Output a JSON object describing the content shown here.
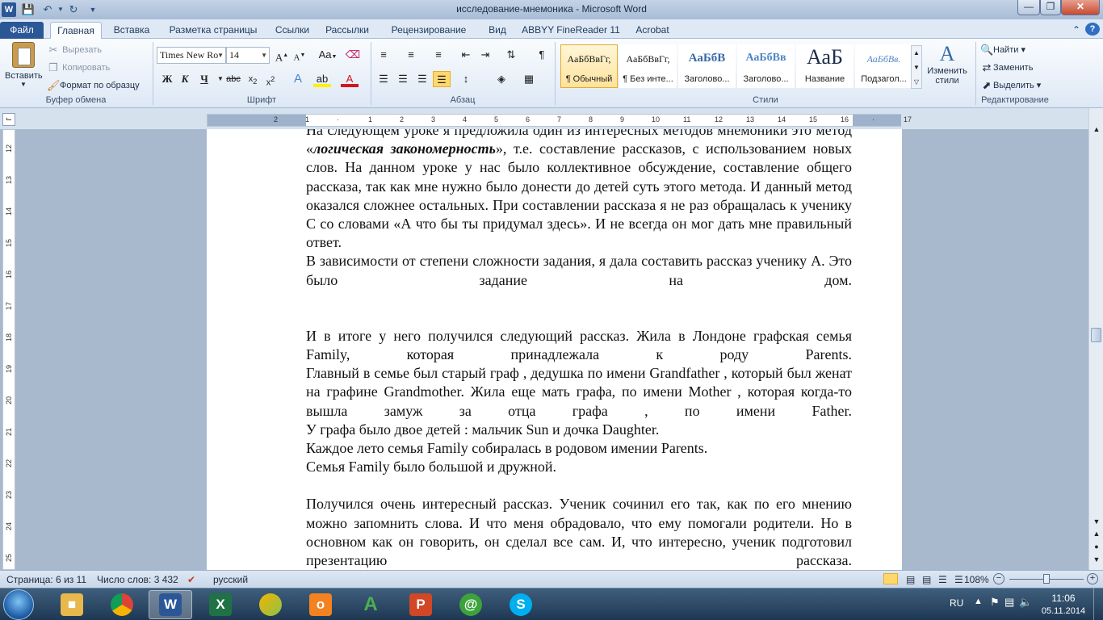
{
  "window": {
    "title": "исследование-мнемоника - Microsoft Word"
  },
  "tabs": [
    "Файл",
    "Главная",
    "Вставка",
    "Разметка страницы",
    "Ссылки",
    "Рассылки",
    "Рецензирование",
    "Вид",
    "ABBYY FineReader 11",
    "Acrobat"
  ],
  "clipboard": {
    "paste": "Вставить",
    "cut": "Вырезать",
    "copy": "Копировать",
    "format_painter": "Формат по образцу",
    "group": "Буфер обмена"
  },
  "font": {
    "name": "Times New Ro",
    "size": "14",
    "group": "Шрифт"
  },
  "paragraph": {
    "group": "Абзац"
  },
  "styles": {
    "group": "Стили",
    "items": [
      {
        "sample": "АаБбВвГг,",
        "name": "¶ Обычный"
      },
      {
        "sample": "АаБбВвГг,",
        "name": "¶ Без инте..."
      },
      {
        "sample": "АаБбВ",
        "name": "Заголово..."
      },
      {
        "sample": "АаБбВв",
        "name": "Заголово..."
      },
      {
        "sample": "АаБ",
        "name": "Название"
      },
      {
        "sample": "АаБбВв.",
        "name": "Подзагол..."
      }
    ],
    "change": "Изменить стили"
  },
  "editing": {
    "group": "Редактирование",
    "find": "Найти",
    "replace": "Заменить",
    "select": "Выделить"
  },
  "document": {
    "p1_a": "На следующем уроке я предложила один из интересных методов мнемоники это метод «",
    "p1_b": "логическая закономерность",
    "p1_c": "», т.е. составление рассказов, с использованием новых слов. На данном уроке у нас было коллективное обсуждение, составление общего рассказа, так как мне нужно было донести до детей суть этого метода. И данный метод оказался сложнее остальных. При составлении рассказа я не раз обращалась к ученику С со словами «А что бы ты придумал здесь». И не всегда он мог дать мне правильный ответ.",
    "p2": "В зависимости от степени сложности задания, я дала составить рассказ ученику А. Это было задание на дом.",
    "p3": "И в итоге у него получился следующий рассказ. Жила в Лондоне графская семья Family, которая принадлежала к роду Parents.",
    "p4": "Главный в  семье был старый граф , дедушка по имени Grandfather , который был женат на  графине Grandmother. Жила еще мать графа, по имени Mother , которая когда-то вышла замуж за отца графа , по имени Father.",
    "p5": "У графа было двое детей : мальчик Sun и дочка Daughter.",
    "p6": "Каждое лето семья Family собиралась в родовом  имении Parents.",
    "p7": "Семья Family было большой и дружной.",
    "p8": "Получился очень интересный рассказ. Ученик сочинил его так, как по его мнению можно запомнить слова. И что меня обрадовало, что ему помогали родители. Но в основном как он говорить, он сделал все сам. И, что интересно, ученик подготовил презентацию рассказа."
  },
  "status": {
    "page": "Страница: 6 из 11",
    "words": "Число слов: 3 432",
    "lang": "русский",
    "zoom": "108%"
  },
  "taskbar": {
    "lang": "RU",
    "time": "11:06",
    "date": "05.11.2014"
  },
  "colors": {
    "file_tab": "#2b5797",
    "accent": "#e3ac2f"
  }
}
